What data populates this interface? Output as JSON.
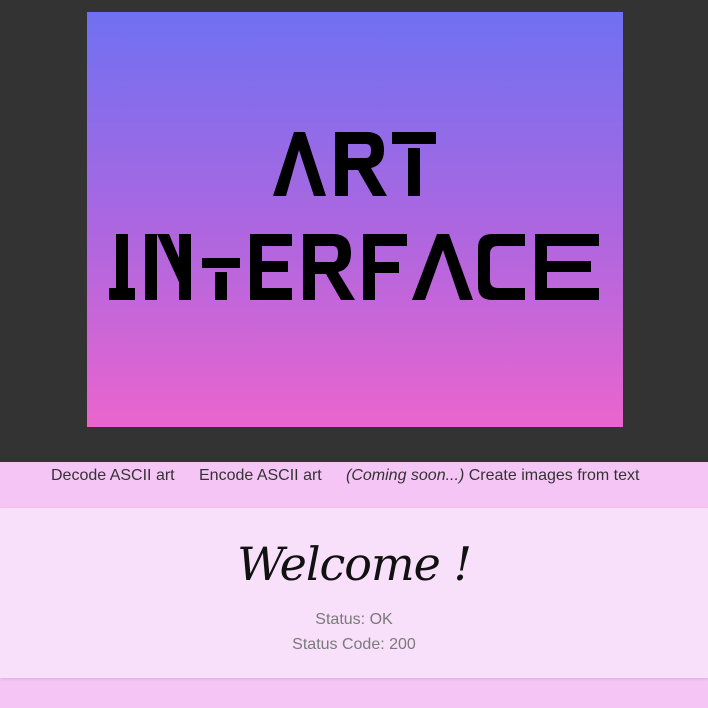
{
  "logo": {
    "line1": "ART",
    "line2": "INTERFACE",
    "gradient_top": "#6f71f2",
    "gradient_bottom": "#ea65cd"
  },
  "nav": {
    "decode_label": "Decode ASCII art",
    "encode_label": "Encode ASCII art",
    "create_soon_label": "(Coming soon...)",
    "create_label": "Create images from text"
  },
  "main": {
    "welcome_text": "Welcome !",
    "status_label": "Status:",
    "status_value": "OK",
    "status_code_label": "Status Code:",
    "status_code_value": "200"
  },
  "colors": {
    "header_bg": "#333333",
    "page_bg": "#f5c6f5",
    "card_bg": "#f8dffa"
  }
}
